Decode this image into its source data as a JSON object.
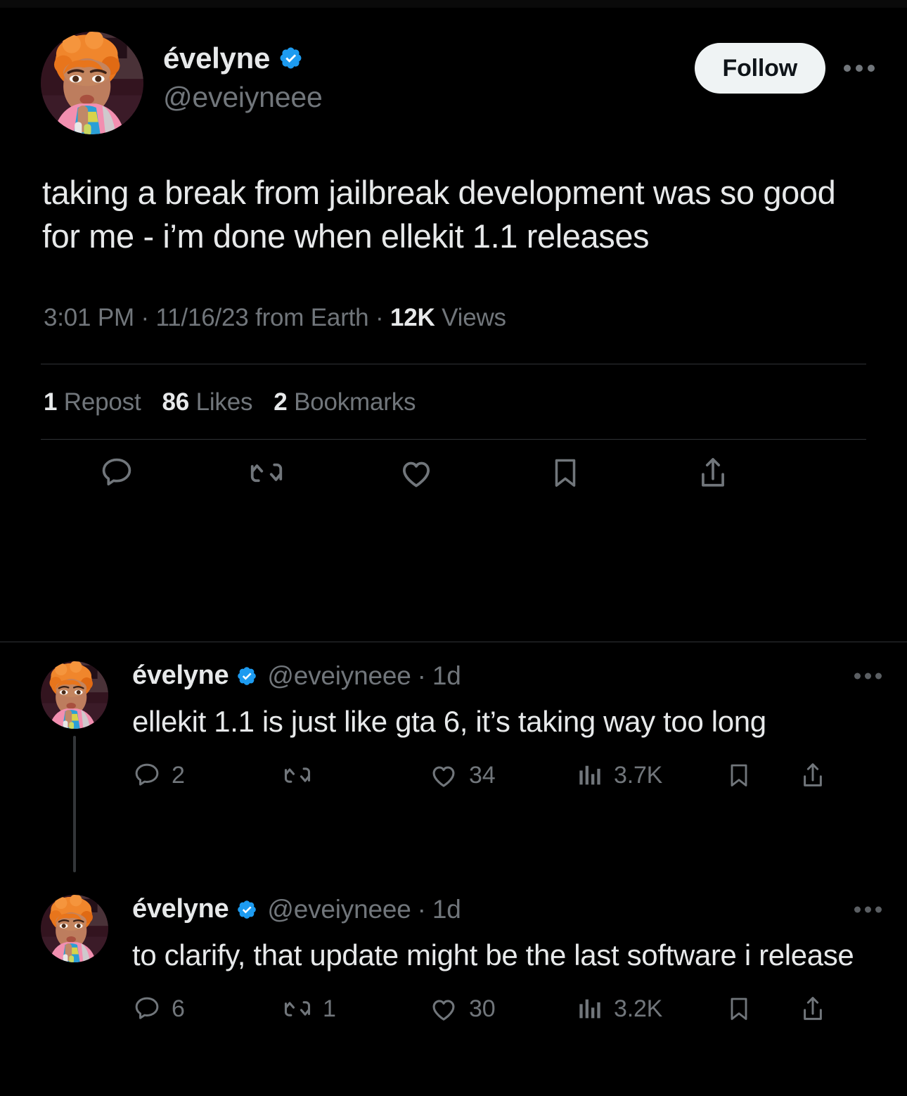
{
  "theme": {
    "background": "#000000",
    "text_primary": "#e7e9ea",
    "text_secondary": "#71767b",
    "accent_verified": "#1d9bf0",
    "divider": "#2f3336",
    "follow_button_bg": "#eff3f4",
    "follow_button_text": "#0f1419"
  },
  "main_tweet": {
    "display_name": "évelyne",
    "handle": "@eveiyneee",
    "verified_badge": "verified-badge-icon",
    "follow_label": "Follow",
    "more_menu": "more-options-icon",
    "text": "taking a break from jailbreak development was so good for me - i’m done when ellekit 1.1 releases",
    "meta": {
      "time": "3:01 PM",
      "dot1": "·",
      "date": "11/16/23",
      "source": "from Earth",
      "dot2": "·",
      "views_count": "12K",
      "views_label": "Views"
    },
    "stats": [
      {
        "count": "1",
        "label": "Repost"
      },
      {
        "count": "86",
        "label": "Likes"
      },
      {
        "count": "2",
        "label": "Bookmarks"
      }
    ],
    "actions": [
      {
        "name": "reply-icon",
        "count": ""
      },
      {
        "name": "repost-icon",
        "count": ""
      },
      {
        "name": "like-icon",
        "count": ""
      },
      {
        "name": "bookmark-icon",
        "count": ""
      },
      {
        "name": "share-icon",
        "count": ""
      }
    ]
  },
  "replies": [
    {
      "display_name": "évelyne",
      "handle": "@eveiyneee",
      "separator": "·",
      "timestamp": "1d",
      "text": "ellekit 1.1 is just like gta 6, it’s taking way too long",
      "reply_count": "2",
      "repost_count": "",
      "like_count": "34",
      "views_count": "3.7K"
    },
    {
      "display_name": "évelyne",
      "handle": "@eveiyneee",
      "separator": "·",
      "timestamp": "1d",
      "text": "to clarify, that update might be the last software i release",
      "reply_count": "6",
      "repost_count": "1",
      "like_count": "30",
      "views_count": "3.2K"
    }
  ]
}
